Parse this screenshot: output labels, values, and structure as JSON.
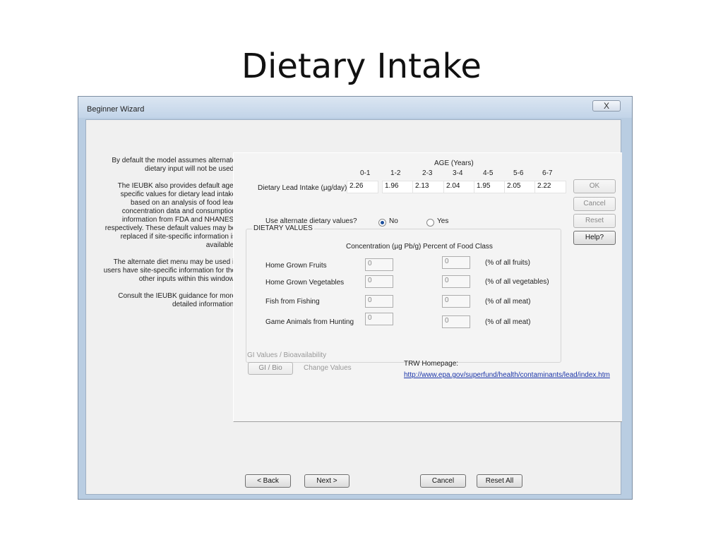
{
  "slide": {
    "title": "Dietary Intake"
  },
  "window": {
    "title": "Beginner Wizard",
    "close": "X"
  },
  "help": [
    "By default the model assumes alternate dietary input will not be used.",
    "The IEUBK also provides default age-specific values for dietary lead intake based on an analysis of food lead concentration data and consumption information from FDA and NHANES, respectively. These default values may be replaced if site-specific information is available.",
    "The alternate diet menu may be used if users have site-specific information for the other inputs within this window.",
    "Consult the IEUBK guidance for more detailed information."
  ],
  "age": {
    "header": "AGE (Years)",
    "ranges": [
      "0-1",
      "1-2",
      "2-3",
      "3-4",
      "4-5",
      "5-6",
      "6-7"
    ],
    "row_label": "Dietary Lead Intake (µg/day)",
    "values": [
      "2.26",
      "1.96",
      "2.13",
      "2.04",
      "1.95",
      "2.05",
      "2.22"
    ]
  },
  "side_buttons": {
    "ok": "OK",
    "cancel": "Cancel",
    "reset": "Reset",
    "help": "Help?"
  },
  "dietary": {
    "title": "DIETARY VALUES",
    "question": "Use alternate dietary values?",
    "no": "No",
    "yes": "Yes",
    "selected": "No",
    "conc_header": "Concentration (µg Pb/g)",
    "pct_header": "Percent of Food Class",
    "rows": [
      {
        "label": "Home Grown Fruits",
        "conc": "0",
        "pct": "0",
        "unit": "(% of all fruits)"
      },
      {
        "label": "Home Grown Vegetables",
        "conc": "0",
        "pct": "0",
        "unit": "(% of all vegetables)"
      },
      {
        "label": "Fish from Fishing",
        "conc": "0",
        "pct": "0",
        "unit": "(% of all meat)"
      },
      {
        "label": "Game Animals from Hunting",
        "conc": "0",
        "pct": "0",
        "unit": "(% of all meat)"
      }
    ]
  },
  "gi": {
    "title": "GI Values / Bioavailability",
    "button": "GI / Bio",
    "change": "Change Values"
  },
  "trw": {
    "label": "TRW Homepage:",
    "url": "http://www.epa.gov/superfund/health/contaminants/lead/index.htm"
  },
  "nav": {
    "back": "< Back",
    "next": "Next >",
    "cancel": "Cancel",
    "reset_all": "Reset All"
  },
  "colors": {
    "link": "#1a34a8",
    "window_frame": "#b9cde2"
  }
}
